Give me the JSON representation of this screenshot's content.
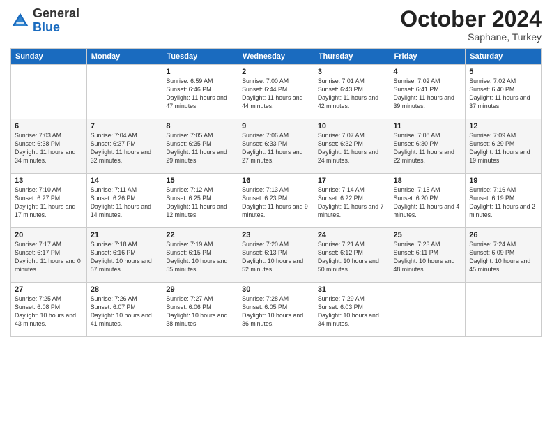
{
  "header": {
    "logo_general": "General",
    "logo_blue": "Blue",
    "month_title": "October 2024",
    "subtitle": "Saphane, Turkey"
  },
  "days_of_week": [
    "Sunday",
    "Monday",
    "Tuesday",
    "Wednesday",
    "Thursday",
    "Friday",
    "Saturday"
  ],
  "weeks": [
    [
      {
        "day": "",
        "sunrise": "",
        "sunset": "",
        "daylight": ""
      },
      {
        "day": "",
        "sunrise": "",
        "sunset": "",
        "daylight": ""
      },
      {
        "day": "1",
        "sunrise": "Sunrise: 6:59 AM",
        "sunset": "Sunset: 6:46 PM",
        "daylight": "Daylight: 11 hours and 47 minutes."
      },
      {
        "day": "2",
        "sunrise": "Sunrise: 7:00 AM",
        "sunset": "Sunset: 6:44 PM",
        "daylight": "Daylight: 11 hours and 44 minutes."
      },
      {
        "day": "3",
        "sunrise": "Sunrise: 7:01 AM",
        "sunset": "Sunset: 6:43 PM",
        "daylight": "Daylight: 11 hours and 42 minutes."
      },
      {
        "day": "4",
        "sunrise": "Sunrise: 7:02 AM",
        "sunset": "Sunset: 6:41 PM",
        "daylight": "Daylight: 11 hours and 39 minutes."
      },
      {
        "day": "5",
        "sunrise": "Sunrise: 7:02 AM",
        "sunset": "Sunset: 6:40 PM",
        "daylight": "Daylight: 11 hours and 37 minutes."
      }
    ],
    [
      {
        "day": "6",
        "sunrise": "Sunrise: 7:03 AM",
        "sunset": "Sunset: 6:38 PM",
        "daylight": "Daylight: 11 hours and 34 minutes."
      },
      {
        "day": "7",
        "sunrise": "Sunrise: 7:04 AM",
        "sunset": "Sunset: 6:37 PM",
        "daylight": "Daylight: 11 hours and 32 minutes."
      },
      {
        "day": "8",
        "sunrise": "Sunrise: 7:05 AM",
        "sunset": "Sunset: 6:35 PM",
        "daylight": "Daylight: 11 hours and 29 minutes."
      },
      {
        "day": "9",
        "sunrise": "Sunrise: 7:06 AM",
        "sunset": "Sunset: 6:33 PM",
        "daylight": "Daylight: 11 hours and 27 minutes."
      },
      {
        "day": "10",
        "sunrise": "Sunrise: 7:07 AM",
        "sunset": "Sunset: 6:32 PM",
        "daylight": "Daylight: 11 hours and 24 minutes."
      },
      {
        "day": "11",
        "sunrise": "Sunrise: 7:08 AM",
        "sunset": "Sunset: 6:30 PM",
        "daylight": "Daylight: 11 hours and 22 minutes."
      },
      {
        "day": "12",
        "sunrise": "Sunrise: 7:09 AM",
        "sunset": "Sunset: 6:29 PM",
        "daylight": "Daylight: 11 hours and 19 minutes."
      }
    ],
    [
      {
        "day": "13",
        "sunrise": "Sunrise: 7:10 AM",
        "sunset": "Sunset: 6:27 PM",
        "daylight": "Daylight: 11 hours and 17 minutes."
      },
      {
        "day": "14",
        "sunrise": "Sunrise: 7:11 AM",
        "sunset": "Sunset: 6:26 PM",
        "daylight": "Daylight: 11 hours and 14 minutes."
      },
      {
        "day": "15",
        "sunrise": "Sunrise: 7:12 AM",
        "sunset": "Sunset: 6:25 PM",
        "daylight": "Daylight: 11 hours and 12 minutes."
      },
      {
        "day": "16",
        "sunrise": "Sunrise: 7:13 AM",
        "sunset": "Sunset: 6:23 PM",
        "daylight": "Daylight: 11 hours and 9 minutes."
      },
      {
        "day": "17",
        "sunrise": "Sunrise: 7:14 AM",
        "sunset": "Sunset: 6:22 PM",
        "daylight": "Daylight: 11 hours and 7 minutes."
      },
      {
        "day": "18",
        "sunrise": "Sunrise: 7:15 AM",
        "sunset": "Sunset: 6:20 PM",
        "daylight": "Daylight: 11 hours and 4 minutes."
      },
      {
        "day": "19",
        "sunrise": "Sunrise: 7:16 AM",
        "sunset": "Sunset: 6:19 PM",
        "daylight": "Daylight: 11 hours and 2 minutes."
      }
    ],
    [
      {
        "day": "20",
        "sunrise": "Sunrise: 7:17 AM",
        "sunset": "Sunset: 6:17 PM",
        "daylight": "Daylight: 11 hours and 0 minutes."
      },
      {
        "day": "21",
        "sunrise": "Sunrise: 7:18 AM",
        "sunset": "Sunset: 6:16 PM",
        "daylight": "Daylight: 10 hours and 57 minutes."
      },
      {
        "day": "22",
        "sunrise": "Sunrise: 7:19 AM",
        "sunset": "Sunset: 6:15 PM",
        "daylight": "Daylight: 10 hours and 55 minutes."
      },
      {
        "day": "23",
        "sunrise": "Sunrise: 7:20 AM",
        "sunset": "Sunset: 6:13 PM",
        "daylight": "Daylight: 10 hours and 52 minutes."
      },
      {
        "day": "24",
        "sunrise": "Sunrise: 7:21 AM",
        "sunset": "Sunset: 6:12 PM",
        "daylight": "Daylight: 10 hours and 50 minutes."
      },
      {
        "day": "25",
        "sunrise": "Sunrise: 7:23 AM",
        "sunset": "Sunset: 6:11 PM",
        "daylight": "Daylight: 10 hours and 48 minutes."
      },
      {
        "day": "26",
        "sunrise": "Sunrise: 7:24 AM",
        "sunset": "Sunset: 6:09 PM",
        "daylight": "Daylight: 10 hours and 45 minutes."
      }
    ],
    [
      {
        "day": "27",
        "sunrise": "Sunrise: 7:25 AM",
        "sunset": "Sunset: 6:08 PM",
        "daylight": "Daylight: 10 hours and 43 minutes."
      },
      {
        "day": "28",
        "sunrise": "Sunrise: 7:26 AM",
        "sunset": "Sunset: 6:07 PM",
        "daylight": "Daylight: 10 hours and 41 minutes."
      },
      {
        "day": "29",
        "sunrise": "Sunrise: 7:27 AM",
        "sunset": "Sunset: 6:06 PM",
        "daylight": "Daylight: 10 hours and 38 minutes."
      },
      {
        "day": "30",
        "sunrise": "Sunrise: 7:28 AM",
        "sunset": "Sunset: 6:05 PM",
        "daylight": "Daylight: 10 hours and 36 minutes."
      },
      {
        "day": "31",
        "sunrise": "Sunrise: 7:29 AM",
        "sunset": "Sunset: 6:03 PM",
        "daylight": "Daylight: 10 hours and 34 minutes."
      },
      {
        "day": "",
        "sunrise": "",
        "sunset": "",
        "daylight": ""
      },
      {
        "day": "",
        "sunrise": "",
        "sunset": "",
        "daylight": ""
      }
    ]
  ]
}
